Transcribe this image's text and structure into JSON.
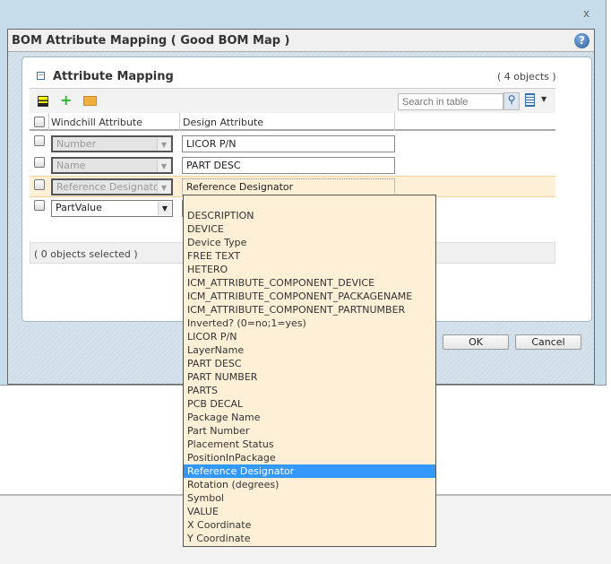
{
  "window": {
    "close_label": "x"
  },
  "dialog": {
    "title": "BOM Attribute Mapping ( Good BOM Map )",
    "help_label": "?"
  },
  "panel": {
    "title": "Attribute Mapping",
    "collapse_label": "−",
    "count": "( 4 objects )",
    "search_placeholder": "Search in table",
    "toolbar_icons": [
      "select-all-icon",
      "add-icon",
      "open-folder-icon",
      "search-icon",
      "table-view-icon"
    ],
    "columns": [
      "Windchill Attribute",
      "Design Attribute"
    ],
    "rows": [
      {
        "windchill": "Number",
        "design": "LICOR P/N",
        "enabled": false
      },
      {
        "windchill": "Name",
        "design": "PART DESC",
        "enabled": false
      },
      {
        "windchill": "Reference Designator",
        "design": "Reference Designator",
        "enabled": false
      },
      {
        "windchill": "PartValue",
        "design": "",
        "enabled": true
      }
    ],
    "status": "( 0 objects selected )"
  },
  "buttons": {
    "ok": "OK",
    "cancel": "Cancel"
  },
  "dropdown": {
    "selected": "Reference Designator",
    "selected_color": "#3399ff",
    "options": [
      "",
      "DESCRIPTION",
      "DEVICE",
      "Device Type",
      "FREE TEXT",
      "HETERO",
      "ICM_ATTRIBUTE_COMPONENT_DEVICE",
      "ICM_ATTRIBUTE_COMPONENT_PACKAGENAME",
      "ICM_ATTRIBUTE_COMPONENT_PARTNUMBER",
      "Inverted? (0=no;1=yes)",
      "LICOR P/N",
      "LayerName",
      "PART DESC",
      "PART NUMBER",
      "PARTS",
      "PCB DECAL",
      "Package Name",
      "Part Number",
      "Placement Status",
      "PositionInPackage",
      "Reference Designator",
      "Rotation (degrees)",
      "Symbol",
      "VALUE",
      "X Coordinate",
      "Y Coordinate"
    ]
  }
}
